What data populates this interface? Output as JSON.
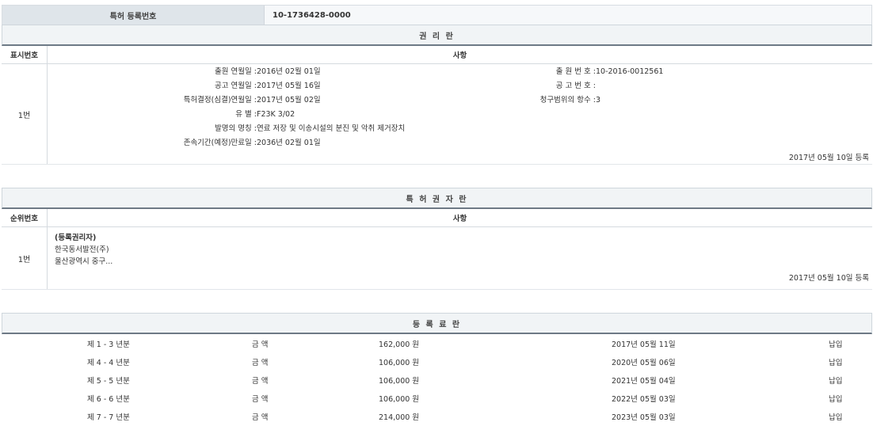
{
  "patent_no": {
    "label": "특허 등록번호",
    "value": "10-1736428-0000"
  },
  "rights": {
    "title": "권 리 란",
    "col_no": "표시번호",
    "col_item": "사항",
    "row_no": "1번",
    "fields_left": [
      {
        "k": "출원 연월일 : ",
        "v": "2016년 02월 01일"
      },
      {
        "k": "공고 연월일 : ",
        "v": "2017년 05월 16일"
      },
      {
        "k": "특허결정(심결)연월일 : ",
        "v": "2017년 05월 02일"
      },
      {
        "k": "유 별 : ",
        "v": "F23K 3/02"
      },
      {
        "k": "발명의 명칭 : ",
        "v": "연료 저장 및 이송시설의 분진 및 악취 제거장치"
      },
      {
        "k": "존속기간(예정)만료일 : ",
        "v": "2036년 02월 01일"
      }
    ],
    "fields_right": [
      {
        "k": "출 원 번 호 : ",
        "v": "10-2016-0012561"
      },
      {
        "k": "공 고 번 호 : ",
        "v": ""
      },
      {
        "k": "청구범위의 항수 : ",
        "v": "3"
      }
    ],
    "reg_date": "2017년 05월 10일 등록"
  },
  "owners": {
    "title": "특 허 권 자 란",
    "col_no": "순위번호",
    "col_item": "사항",
    "row_no": "1번",
    "lines": [
      "(등록권리자)",
      "한국동서발전(주)",
      "울산광역시 중구..."
    ],
    "reg_date": "2017년 05월 10일 등록"
  },
  "fees": {
    "title": "등 록 료 란",
    "rows": [
      {
        "period": "제 1 - 3 년분",
        "label": "금 액",
        "amount": "162,000 원",
        "date": "2017년 05월 11일",
        "status": "납입"
      },
      {
        "period": "제 4 - 4 년분",
        "label": "금 액",
        "amount": "106,000 원",
        "date": "2020년 05월 06일",
        "status": "납입"
      },
      {
        "period": "제 5 - 5 년분",
        "label": "금 액",
        "amount": "106,000 원",
        "date": "2021년 05월 04일",
        "status": "납입"
      },
      {
        "period": "제 6 - 6 년분",
        "label": "금 액",
        "amount": "106,000 원",
        "date": "2022년 05월 03일",
        "status": "납입"
      },
      {
        "period": "제 7 - 7 년분",
        "label": "금 액",
        "amount": "214,000 원",
        "date": "2023년 05월 03일",
        "status": "납입"
      }
    ]
  }
}
